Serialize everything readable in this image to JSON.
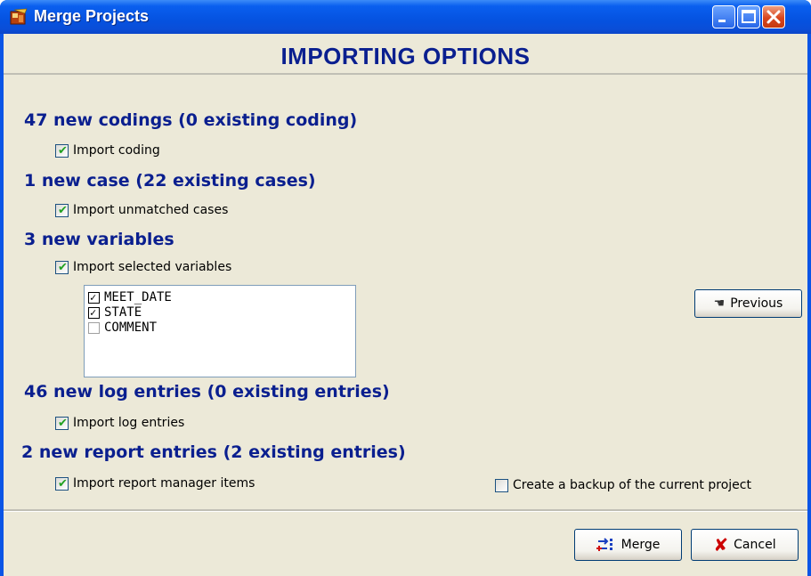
{
  "window": {
    "title": "Merge Projects",
    "icons": [
      "app-icon",
      "minimize-icon",
      "maximize-icon",
      "close-icon"
    ]
  },
  "header": {
    "title": "IMPORTING OPTIONS"
  },
  "sections": {
    "codings": {
      "heading": "47 new codings (0 existing coding)",
      "checkbox_label": "Import coding",
      "checked": true
    },
    "cases": {
      "heading": "1 new case (22 existing cases)",
      "checkbox_label": "Import unmatched cases",
      "checked": true
    },
    "variables": {
      "heading": "3 new variables",
      "checkbox_label": "Import selected variables",
      "checked": true,
      "items": [
        {
          "label": "MEET_DATE",
          "checked": true
        },
        {
          "label": "STATE",
          "checked": true
        },
        {
          "label": "COMMENT",
          "checked": false
        }
      ]
    },
    "log": {
      "heading": "46 new log entries (0 existing entries)",
      "checkbox_label": "Import log entries",
      "checked": true
    },
    "report": {
      "heading": "2 new report entries (2 existing entries)",
      "checkbox_label": "Import report manager items",
      "checked": true
    }
  },
  "backup": {
    "label": "Create a backup of the current project",
    "checked": false
  },
  "buttons": {
    "previous": "Previous",
    "merge": "Merge",
    "cancel": "Cancel"
  },
  "colors": {
    "heading": "#0A1F8F",
    "titlebar": "#0A55E6",
    "client_bg": "#ECE9D8",
    "check_green": "#21A121",
    "cancel_x": "#CC0000"
  }
}
